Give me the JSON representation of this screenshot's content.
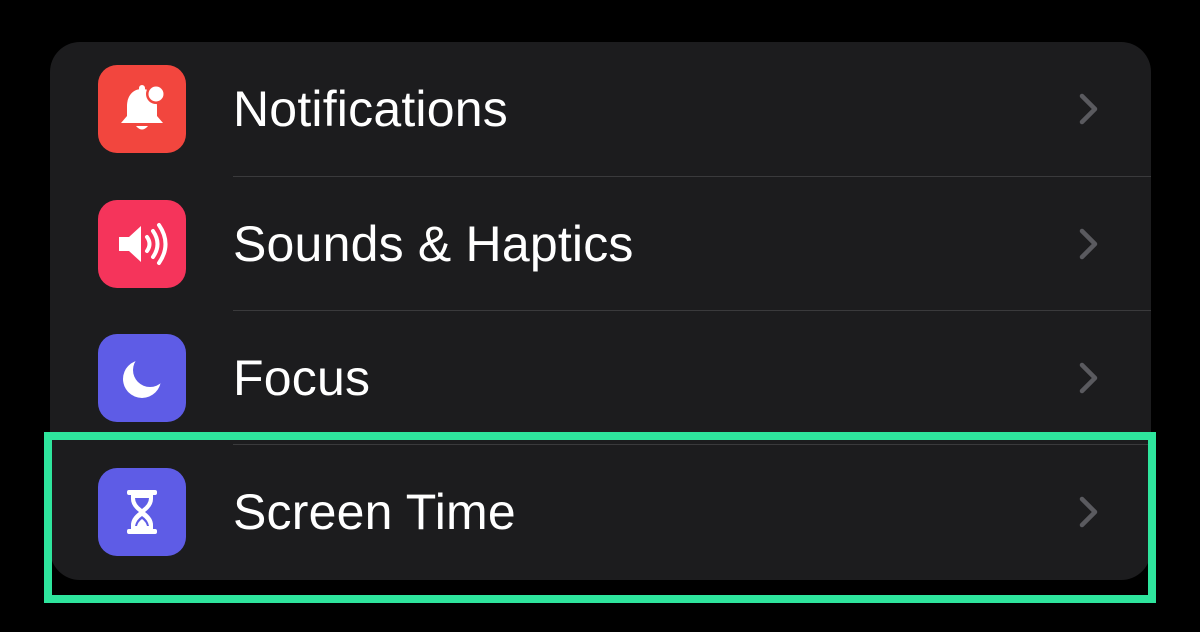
{
  "settings_list": {
    "items": [
      {
        "label": "Notifications",
        "icon": "bell-badge-icon",
        "icon_bg": "#f2463e"
      },
      {
        "label": "Sounds & Haptics",
        "icon": "speaker-wave-icon",
        "icon_bg": "#f5345b"
      },
      {
        "label": "Focus",
        "icon": "moon-icon",
        "icon_bg": "#5e5ce6"
      },
      {
        "label": "Screen Time",
        "icon": "hourglass-icon",
        "icon_bg": "#5e5ce6"
      }
    ],
    "chevron_icon": "chevron-right-icon",
    "highlighted_item": "Screen Time",
    "highlight_color": "#2ee59d",
    "group_background": "#1c1c1e",
    "page_background": "#000000"
  }
}
